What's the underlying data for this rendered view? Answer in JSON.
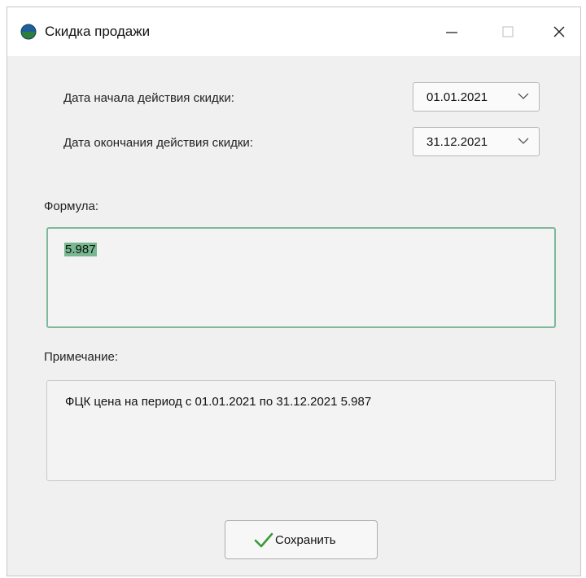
{
  "window": {
    "title": "Скидка продажи",
    "icon": "app-globe-icon"
  },
  "dates": {
    "start_label": "Дата начала действия скидки:",
    "start_value": "01.01.2021",
    "end_label": "Дата окончания действия скидки:",
    "end_value": "31.12.2021"
  },
  "formula": {
    "label": "Формула:",
    "value": "5.987"
  },
  "note": {
    "label": "Примечание:",
    "value": "ФЦК цена на период с 01.01.2021 по 31.12.2021 5.987"
  },
  "actions": {
    "save_label": "Сохранить",
    "save_icon": "checkmark-icon"
  },
  "colors": {
    "focus_border": "#7fb89a",
    "selection": "#78b890",
    "check": "#3a9a3a"
  }
}
